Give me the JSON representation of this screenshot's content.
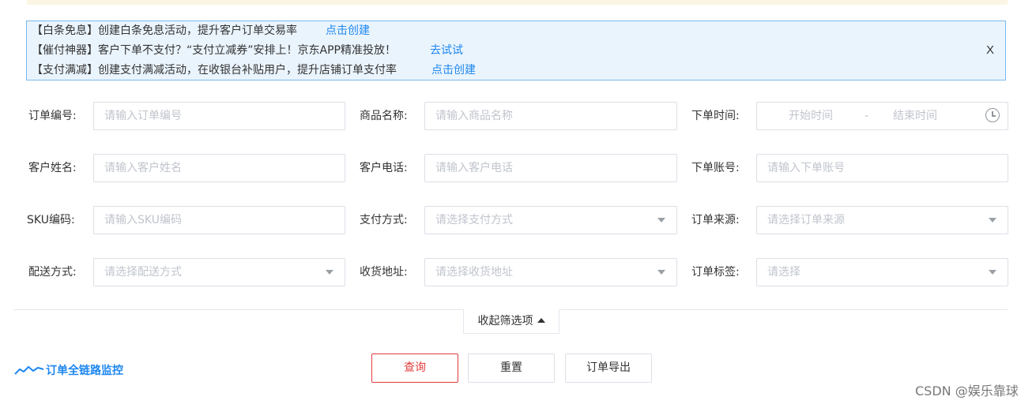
{
  "notice": {
    "lines": [
      {
        "text": "【白条免息】创建白条免息活动，提升客户订单交易率",
        "link": "点击创建"
      },
      {
        "text": "【催付神器】客户下单不支付？“支付立减券”安排上！京东APP精准投放！",
        "link": "去试试"
      },
      {
        "text": "【支付满减】创建支付满减活动，在收银台补贴用户，提升店铺订单支付率",
        "link": "点击创建"
      }
    ],
    "close": "X"
  },
  "filters": {
    "order_no": {
      "label": "订单编号:",
      "placeholder": "请输入订单编号"
    },
    "product_name": {
      "label": "商品名称:",
      "placeholder": "请输入商品名称"
    },
    "order_time": {
      "label": "下单时间:",
      "start": "开始时间",
      "separator": "-",
      "end": "结束时间"
    },
    "customer_name": {
      "label": "客户姓名:",
      "placeholder": "请输入客户姓名"
    },
    "customer_phone": {
      "label": "客户电话:",
      "placeholder": "请输入客户电话"
    },
    "order_account": {
      "label": "下单账号:",
      "placeholder": "请输入下单账号"
    },
    "sku": {
      "label": "SKU编码:",
      "placeholder": "请输入SKU编码"
    },
    "payment_method": {
      "label": "支付方式:",
      "placeholder": "请选择支付方式"
    },
    "order_source": {
      "label": "订单来源:",
      "placeholder": "请选择订单来源"
    },
    "delivery_method": {
      "label": "配送方式:",
      "placeholder": "请选择配送方式"
    },
    "shipping_address": {
      "label": "收货地址:",
      "placeholder": "请选择收货地址"
    },
    "order_tag": {
      "label": "订单标签:",
      "placeholder": "请选择"
    }
  },
  "collapse_label": "收起筛选项",
  "monitor_label": "订单全链路监控",
  "buttons": {
    "search": "查询",
    "reset": "重置",
    "export": "订单导出"
  },
  "watermark": "CSDN @娱乐靠球",
  "colors": {
    "link": "#1e87f0",
    "notice_bg": "#eaf4fd",
    "notice_border": "#79b9ec",
    "primary": "#e23c3c"
  }
}
